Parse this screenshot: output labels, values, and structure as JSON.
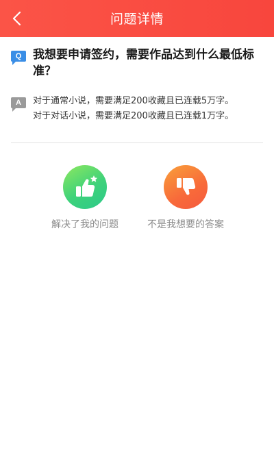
{
  "header": {
    "title": "问题详情",
    "back_icon": "chevron-left-icon"
  },
  "question": {
    "badge": "Q",
    "text": "我想要申请签约，需要作品达到什么最低标准？"
  },
  "answer": {
    "badge": "A",
    "lines": [
      "对于通常小说，需要满足200收藏且已连载5万字。",
      "对于对话小说，需要满足200收藏且已连载1万字。"
    ]
  },
  "feedback": {
    "solved_label": "解决了我的问题",
    "unsolved_label": "不是我想要的答案",
    "solved_icon": "thumbs-up-star-icon",
    "unsolved_icon": "thumbs-down-icon"
  },
  "colors": {
    "header": "#f94b41",
    "q_badge": "#3a8ee6",
    "a_badge": "#9a9a9a",
    "solved": "#3ed27a",
    "unsolved": "#f86a3a"
  }
}
